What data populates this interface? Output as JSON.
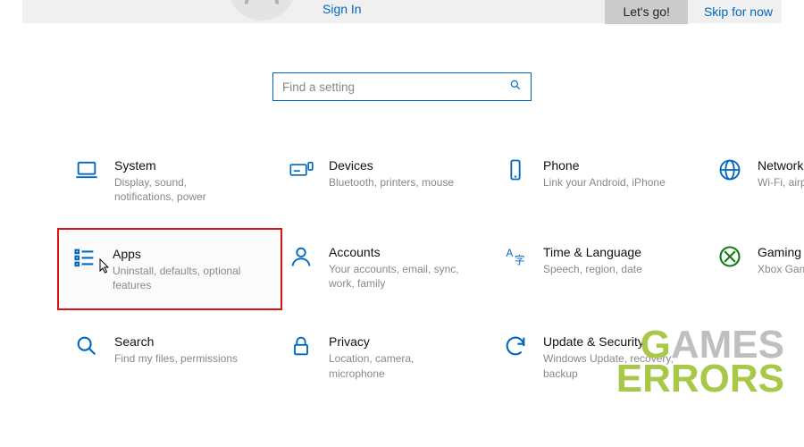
{
  "header": {
    "signin": "Sign In",
    "lets_go": "Let's go!",
    "skip": "Skip for now"
  },
  "search": {
    "placeholder": "Find a setting"
  },
  "tiles": {
    "system": {
      "title": "System",
      "desc": "Display, sound, notifications, power"
    },
    "devices": {
      "title": "Devices",
      "desc": "Bluetooth, printers, mouse"
    },
    "phone": {
      "title": "Phone",
      "desc": "Link your Android, iPhone"
    },
    "network": {
      "title": "Network",
      "desc": "Wi-Fi, airplane mode"
    },
    "apps": {
      "title": "Apps",
      "desc": "Uninstall, defaults, optional features"
    },
    "accounts": {
      "title": "Accounts",
      "desc": "Your accounts, email, sync, work, family"
    },
    "time": {
      "title": "Time & Language",
      "desc": "Speech, region, date"
    },
    "gaming": {
      "title": "Gaming",
      "desc": "Xbox Game Bar, captures, Game Mode"
    },
    "search_tile": {
      "title": "Search",
      "desc": "Find my files, permissions"
    },
    "privacy": {
      "title": "Privacy",
      "desc": "Location, camera, microphone"
    },
    "update": {
      "title": "Update & Security",
      "desc": "Windows Update, recovery, backup"
    }
  },
  "watermark": {
    "line1a": "G",
    "line1b": "A",
    "line1c": "MES",
    "line2": "ERRORS"
  }
}
